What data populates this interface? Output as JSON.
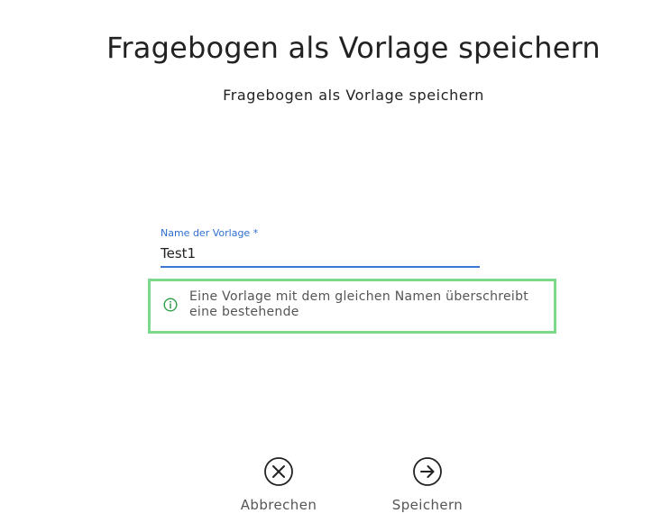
{
  "dialog": {
    "title": "Fragebogen als Vorlage speichern",
    "subtitle": "Fragebogen als Vorlage speichern"
  },
  "form": {
    "name_label": "Name der Vorlage *",
    "name_value": "Test1"
  },
  "info": {
    "icon": "info-circle-icon",
    "message": "Eine Vorlage mit dem gleichen Namen überschreibt eine bestehende"
  },
  "actions": {
    "cancel": {
      "icon": "close-circle-icon",
      "label": "Abbrechen"
    },
    "save": {
      "icon": "arrow-right-circle-icon",
      "label": "Speichern"
    }
  },
  "colors": {
    "accent": "#3a78d4",
    "info_border": "#7cd88a",
    "info_icon": "#2e9e44"
  }
}
